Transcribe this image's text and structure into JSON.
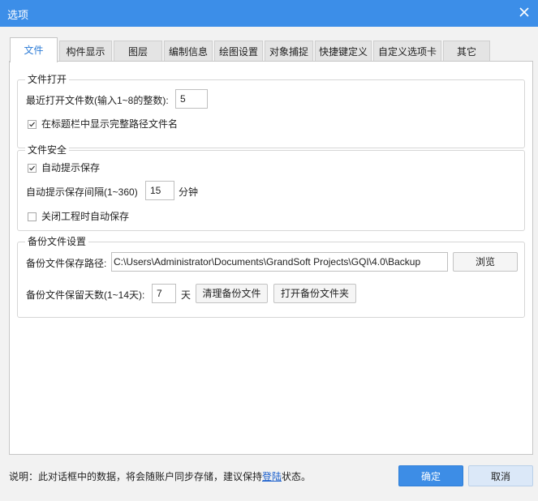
{
  "window": {
    "title": "选项",
    "close_icon": "close-icon"
  },
  "tabs": [
    {
      "label": "文件",
      "active": true
    },
    {
      "label": "构件显示"
    },
    {
      "label": "图层"
    },
    {
      "label": "编制信息"
    },
    {
      "label": "绘图设置"
    },
    {
      "label": "对象捕捉"
    },
    {
      "label": "快捷键定义"
    },
    {
      "label": "自定义选项卡"
    },
    {
      "label": "其它"
    }
  ],
  "file_open": {
    "legend": "文件打开",
    "recent_count_label": "最近打开文件数(输入1~8的整数):",
    "recent_count_value": "5",
    "show_full_path_label": "在标题栏中显示完整路径文件名",
    "show_full_path_checked": true
  },
  "file_safety": {
    "legend": "文件安全",
    "auto_prompt_save_label": "自动提示保存",
    "auto_prompt_save_checked": true,
    "interval_label": "自动提示保存间隔(1~360)",
    "interval_value": "15",
    "interval_unit": "分钟",
    "autosave_on_close_label": "关闭工程时自动保存",
    "autosave_on_close_checked": false
  },
  "backup": {
    "legend": "备份文件设置",
    "path_label": "备份文件保存路径:",
    "path_value": "C:\\Users\\Administrator\\Documents\\GrandSoft Projects\\GQI\\4.0\\Backup",
    "browse_label": "浏览",
    "days_label": "备份文件保留天数(1~14天):",
    "days_value": "7",
    "days_unit": "天",
    "clean_label": "清理备份文件",
    "open_folder_label": "打开备份文件夹"
  },
  "footer": {
    "note_prefix": "说明：此对话框中的数据，将会随账户同步存储，建议保持",
    "note_link": "登陆",
    "note_suffix": "状态。",
    "ok_label": "确定",
    "cancel_label": "取消"
  },
  "colors": {
    "titlebar": "#3c8ee8",
    "accent": "#2b7bd6",
    "ok_button": "#3d8de6",
    "link": "#1a5fcc"
  }
}
